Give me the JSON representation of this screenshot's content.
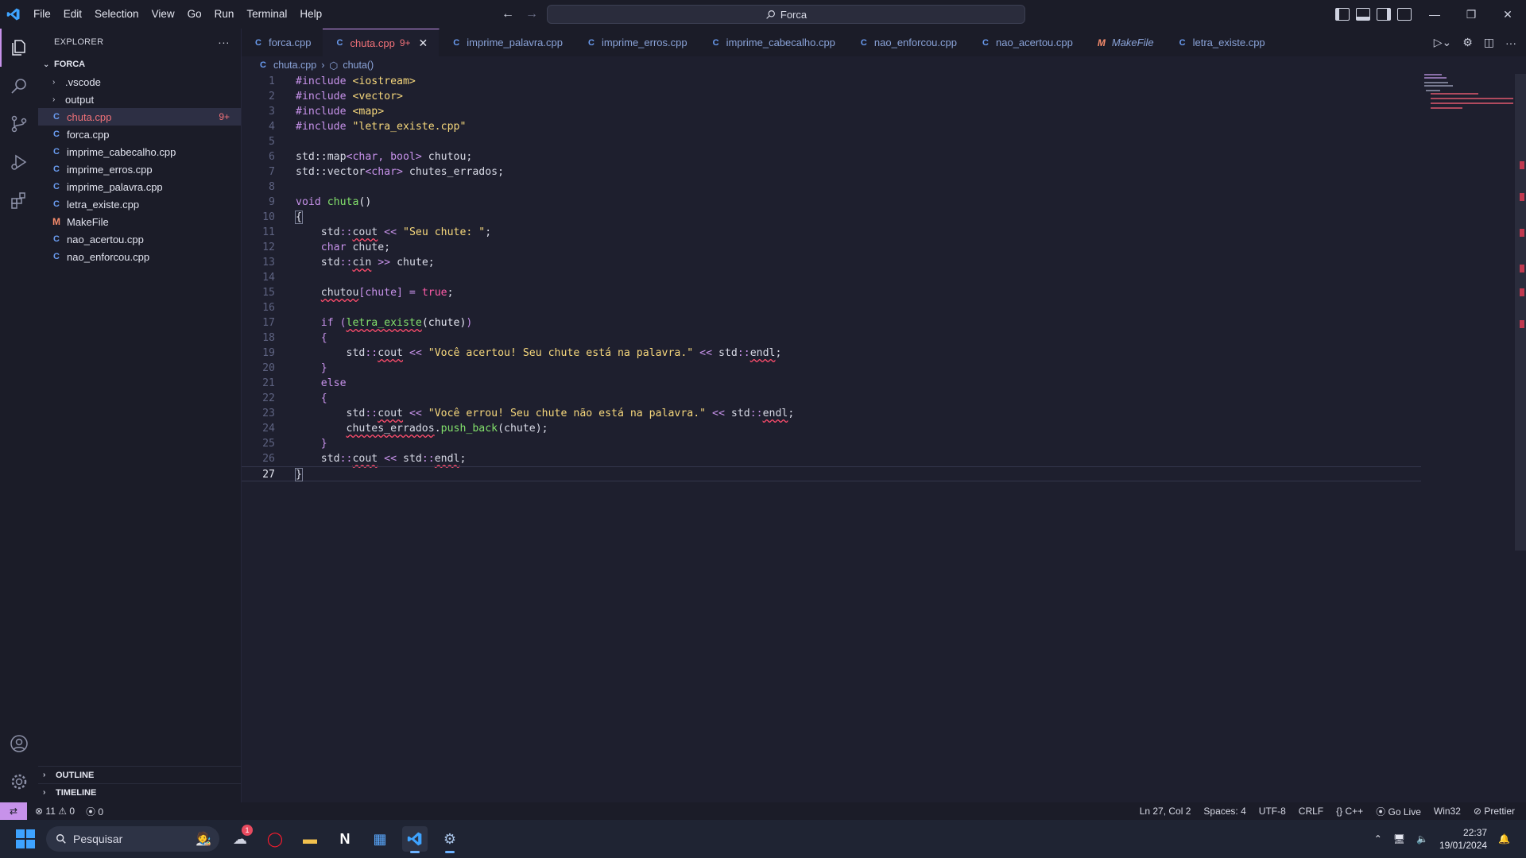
{
  "titlebar": {
    "menu": [
      "File",
      "Edit",
      "Selection",
      "View",
      "Go",
      "Run",
      "Terminal",
      "Help"
    ],
    "search_text": "Forca"
  },
  "sidebar": {
    "header": "EXPLORER",
    "more": "···",
    "project": "FORCA",
    "folders": [
      ".vscode",
      "output"
    ],
    "files": [
      {
        "name": "chuta.cpp",
        "type": "cpp",
        "badge": "9+",
        "selected": true
      },
      {
        "name": "forca.cpp",
        "type": "cpp"
      },
      {
        "name": "imprime_cabecalho.cpp",
        "type": "cpp"
      },
      {
        "name": "imprime_erros.cpp",
        "type": "cpp"
      },
      {
        "name": "imprime_palavra.cpp",
        "type": "cpp"
      },
      {
        "name": "letra_existe.cpp",
        "type": "cpp"
      },
      {
        "name": "MakeFile",
        "type": "make"
      },
      {
        "name": "nao_acertou.cpp",
        "type": "cpp"
      },
      {
        "name": "nao_enforcou.cpp",
        "type": "cpp"
      }
    ],
    "outline": "OUTLINE",
    "timeline": "TIMELINE"
  },
  "tabs": [
    {
      "name": "forca.cpp"
    },
    {
      "name": "chuta.cpp",
      "mod": "9+",
      "active": true
    },
    {
      "name": "imprime_palavra.cpp"
    },
    {
      "name": "imprime_erros.cpp"
    },
    {
      "name": "imprime_cabecalho.cpp"
    },
    {
      "name": "nao_enforcou.cpp"
    },
    {
      "name": "nao_acertou.cpp"
    },
    {
      "name": "MakeFile",
      "make": true
    },
    {
      "name": "letra_existe.cpp"
    }
  ],
  "breadcrumb": {
    "file": "chuta.cpp",
    "symbol": "chuta()"
  },
  "code": {
    "line_numbers": [
      "1",
      "2",
      "3",
      "4",
      "5",
      "6",
      "7",
      "8",
      "9",
      "10",
      "11",
      "12",
      "13",
      "14",
      "15",
      "16",
      "17",
      "18",
      "19",
      "20",
      "21",
      "22",
      "23",
      "24",
      "25",
      "26",
      "27"
    ],
    "l1_a": "#include",
    "l1_b": " <iostream>",
    "l2_a": "#include",
    "l2_b": " <vector>",
    "l3_a": "#include",
    "l3_b": " <map>",
    "l4_a": "#include",
    "l4_b": " \"letra_existe.cpp\"",
    "l6_a": "std::map",
    "l6_b": "<char,",
    "l6_c": " bool>",
    "l6_d": " chutou;",
    "l7_a": "std::vector",
    "l7_b": "<char>",
    "l7_c": " chutes_errados;",
    "l9_a": "void",
    "l9_b": " chuta",
    "l9_c": "()",
    "l10": "{",
    "l11_a": "    std",
    "l11_b": "::",
    "l11_c": "cout",
    "l11_d": " <<",
    "l11_e": " \"Seu chute: \"",
    "l11_f": ";",
    "l12_a": "    char",
    "l12_b": " chute;",
    "l13_a": "    std",
    "l13_b": "::",
    "l13_c": "cin",
    "l13_d": " >>",
    "l13_e": " chute;",
    "l15_a": "    ",
    "l15_b": "chutou",
    "l15_c": "[chute]",
    "l15_d": " =",
    "l15_e": " true",
    "l15_f": ";",
    "l17_a": "    if",
    "l17_b": " (",
    "l17_c": "letra_existe",
    "l17_d": "(chute)",
    "l17_e": ")",
    "l18": "    {",
    "l19_a": "        std",
    "l19_b": "::",
    "l19_c": "cout",
    "l19_d": " <<",
    "l19_e": " \"Você acertou! Seu chute está na palavra.\"",
    "l19_f": " <<",
    "l19_g": " std",
    "l19_h": "::",
    "l19_i": "endl",
    "l19_j": ";",
    "l20": "    }",
    "l21": "    else",
    "l22": "    {",
    "l23_a": "        std",
    "l23_b": "::",
    "l23_c": "cout",
    "l23_d": " <<",
    "l23_e": " \"Você errou! Seu chute não está na palavra.\"",
    "l23_f": " <<",
    "l23_g": " std",
    "l23_h": "::",
    "l23_i": "endl",
    "l23_j": ";",
    "l24_a": "        ",
    "l24_b": "chutes_errados",
    "l24_c": ".",
    "l24_d": "push_back",
    "l24_e": "(chute);",
    "l25": "    }",
    "l26_a": "    std",
    "l26_b": "::",
    "l26_c": "cout",
    "l26_d": " <<",
    "l26_e": " std",
    "l26_f": "::",
    "l26_g": "endl",
    "l26_h": ";",
    "l27": "}"
  },
  "statusbar": {
    "errors": "11",
    "warnings": "0",
    "ports": "0",
    "position": "Ln 27, Col 2",
    "spaces": "Spaces: 4",
    "encoding": "UTF-8",
    "eol": "CRLF",
    "language": "C++",
    "go_live": "Go Live",
    "platform": "Win32",
    "prettier": "Prettier"
  },
  "taskbar": {
    "search": "Pesquisar",
    "notification_count": "1",
    "time": "22:37",
    "date": "19/01/2024"
  },
  "colors": {
    "accent": "#c792ea",
    "error": "#f07178",
    "file_icon": "#6b9df2"
  }
}
